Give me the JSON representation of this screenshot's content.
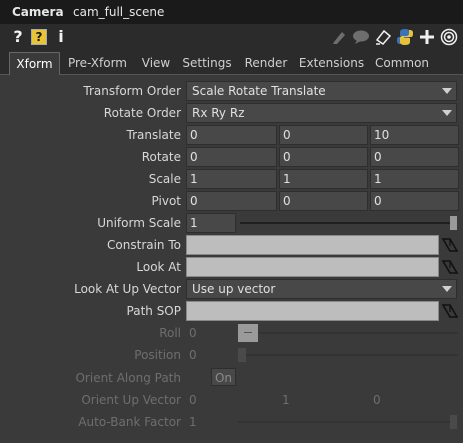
{
  "header": {
    "node_type": "Camera",
    "node_name": "cam_full_scene"
  },
  "toolbar_icons": [
    "help-icon",
    "help-box-icon",
    "info-icon",
    "edit-icon",
    "comment-icon",
    "bookmark-icon",
    "python-icon",
    "add-icon",
    "target-icon"
  ],
  "toolbar_glyphs": {
    "help": "?",
    "help_box": "?",
    "info": "i"
  },
  "tabs": [
    "Xform",
    "Pre-Xform",
    "View",
    "Settings",
    "Render",
    "Extensions",
    "Common"
  ],
  "active_tab": "Xform",
  "params": {
    "transform_order": {
      "label": "Transform Order",
      "value": "Scale Rotate Translate"
    },
    "rotate_order": {
      "label": "Rotate Order",
      "value": "Rx Ry Rz"
    },
    "translate": {
      "label": "Translate",
      "x": "0",
      "y": "0",
      "z": "10"
    },
    "rotate": {
      "label": "Rotate",
      "x": "0",
      "y": "0",
      "z": "0"
    },
    "scale": {
      "label": "Scale",
      "x": "1",
      "y": "1",
      "z": "1"
    },
    "pivot": {
      "label": "Pivot",
      "x": "0",
      "y": "0",
      "z": "0"
    },
    "uniform_scale": {
      "label": "Uniform Scale",
      "value": "1"
    },
    "constrain_to": {
      "label": "Constrain To",
      "value": ""
    },
    "look_at": {
      "label": "Look At",
      "value": ""
    },
    "look_at_up_vector": {
      "label": "Look At Up Vector",
      "value": "Use up vector"
    },
    "path_sop": {
      "label": "Path SOP",
      "value": ""
    },
    "roll": {
      "label": "Roll",
      "value": "0"
    },
    "position": {
      "label": "Position",
      "value": "0"
    },
    "orient_along_path": {
      "label": "Orient Along Path",
      "value": "On"
    },
    "orient_up_vector": {
      "label": "Orient Up Vector",
      "x": "0",
      "y": "1",
      "z": "0"
    },
    "auto_bank_factor": {
      "label": "Auto-Bank Factor",
      "value": "1"
    }
  },
  "colors": {
    "panel_bg": "#3a3a3a",
    "header_bg": "#1a1a1a",
    "field_bg": "#484848",
    "op_field_bg": "#bdbdbd",
    "help_box_bg": "#e8c437"
  }
}
